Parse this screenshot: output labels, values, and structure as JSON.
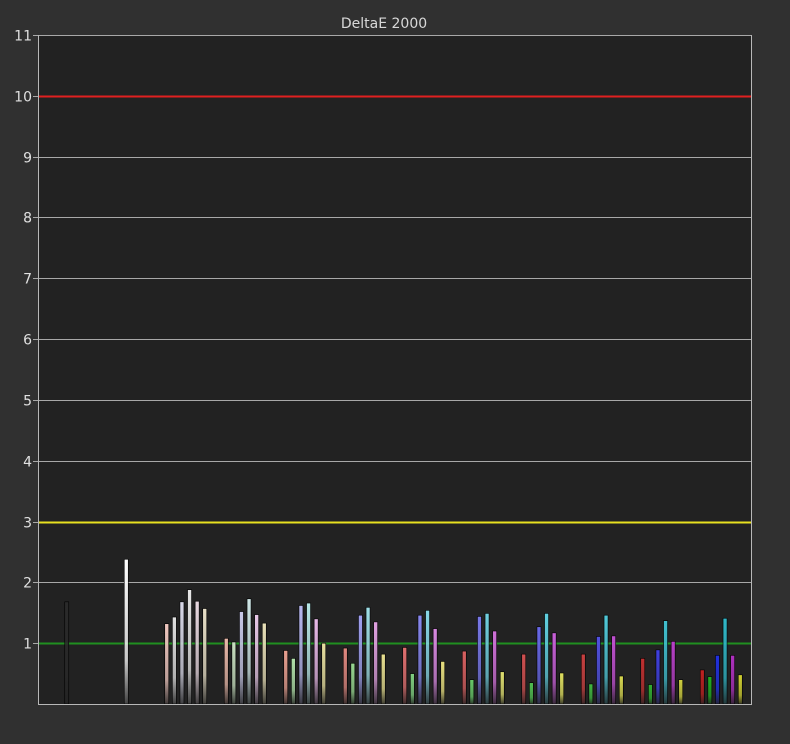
{
  "chart_data": {
    "type": "bar",
    "title": "DeltaE 2000",
    "xlabel": "",
    "ylabel": "",
    "ylim": [
      0,
      11
    ],
    "yticks": [
      1,
      2,
      3,
      4,
      5,
      6,
      7,
      8,
      9,
      10,
      11
    ],
    "grid": true,
    "reference_lines": [
      {
        "value": 10,
        "color": "#e02020"
      },
      {
        "value": 3,
        "color": "#e8e020"
      },
      {
        "value": 1,
        "color": "#209020"
      }
    ],
    "groups": [
      {
        "bars": [
          {
            "value": 1.68,
            "color": "#2a2a2a"
          }
        ]
      },
      {
        "bars": [
          {
            "value": 2.38,
            "color": "#ffffff"
          }
        ]
      },
      {
        "bars": [
          {
            "value": 1.32,
            "color": "#f0c8c0"
          },
          {
            "value": 1.43,
            "color": "#e0e0e0"
          },
          {
            "value": 1.68,
            "color": "#d8d8e8"
          },
          {
            "value": 1.88,
            "color": "#e8e8e8"
          },
          {
            "value": 1.69,
            "color": "#e8d8e0"
          },
          {
            "value": 1.57,
            "color": "#e8e0c8"
          }
        ]
      },
      {
        "bars": [
          {
            "value": 1.08,
            "color": "#e8b8a8"
          },
          {
            "value": 1.02,
            "color": "#c8e0c0"
          },
          {
            "value": 1.52,
            "color": "#c8c8e8"
          },
          {
            "value": 1.73,
            "color": "#d0e8e8"
          },
          {
            "value": 1.47,
            "color": "#e8c8e8"
          },
          {
            "value": 1.33,
            "color": "#e8e0b8"
          }
        ]
      },
      {
        "bars": [
          {
            "value": 0.88,
            "color": "#e8a090"
          },
          {
            "value": 0.75,
            "color": "#b0e0a8"
          },
          {
            "value": 1.62,
            "color": "#b8b8f0"
          },
          {
            "value": 1.66,
            "color": "#b8e8e8"
          },
          {
            "value": 1.4,
            "color": "#e8b8e8"
          },
          {
            "value": 1.0,
            "color": "#e8e0a0"
          }
        ]
      },
      {
        "bars": [
          {
            "value": 0.92,
            "color": "#e08880"
          },
          {
            "value": 0.67,
            "color": "#98d890"
          },
          {
            "value": 1.46,
            "color": "#a0a0f0"
          },
          {
            "value": 1.59,
            "color": "#a0e0e8"
          },
          {
            "value": 1.35,
            "color": "#e0a0e0"
          },
          {
            "value": 0.82,
            "color": "#e8e090"
          }
        ]
      },
      {
        "bars": [
          {
            "value": 0.93,
            "color": "#e07070"
          },
          {
            "value": 0.5,
            "color": "#80d080"
          },
          {
            "value": 1.46,
            "color": "#8888f0"
          },
          {
            "value": 1.54,
            "color": "#88d8e8"
          },
          {
            "value": 1.24,
            "color": "#d888e0"
          },
          {
            "value": 0.7,
            "color": "#e8e080"
          }
        ]
      },
      {
        "bars": [
          {
            "value": 0.87,
            "color": "#d86060"
          },
          {
            "value": 0.4,
            "color": "#68c868"
          },
          {
            "value": 1.44,
            "color": "#7878e8"
          },
          {
            "value": 1.49,
            "color": "#70d0e0"
          },
          {
            "value": 1.2,
            "color": "#d070d8"
          },
          {
            "value": 0.53,
            "color": "#e0e070"
          }
        ]
      },
      {
        "bars": [
          {
            "value": 0.82,
            "color": "#d05050"
          },
          {
            "value": 0.35,
            "color": "#50c050"
          },
          {
            "value": 1.27,
            "color": "#6868e8"
          },
          {
            "value": 1.49,
            "color": "#60d0e0"
          },
          {
            "value": 1.17,
            "color": "#c860d8"
          },
          {
            "value": 0.51,
            "color": "#e0e060"
          }
        ]
      },
      {
        "bars": [
          {
            "value": 0.82,
            "color": "#c84040"
          },
          {
            "value": 0.33,
            "color": "#40b840"
          },
          {
            "value": 1.11,
            "color": "#5050e0"
          },
          {
            "value": 1.46,
            "color": "#50c8d8"
          },
          {
            "value": 1.12,
            "color": "#c050d0"
          },
          {
            "value": 0.46,
            "color": "#d8d850"
          }
        ]
      },
      {
        "bars": [
          {
            "value": 0.75,
            "color": "#c03030"
          },
          {
            "value": 0.32,
            "color": "#30b030"
          },
          {
            "value": 0.89,
            "color": "#4040e0"
          },
          {
            "value": 1.37,
            "color": "#40c0d0"
          },
          {
            "value": 1.03,
            "color": "#b840c8"
          },
          {
            "value": 0.4,
            "color": "#d0d040"
          }
        ]
      },
      {
        "bars": [
          {
            "value": 0.56,
            "color": "#c02020"
          },
          {
            "value": 0.45,
            "color": "#20b020"
          },
          {
            "value": 0.8,
            "color": "#2030e0"
          },
          {
            "value": 1.41,
            "color": "#30b8c8"
          },
          {
            "value": 0.8,
            "color": "#b030c0"
          },
          {
            "value": 0.48,
            "color": "#d0d030"
          }
        ]
      }
    ]
  }
}
